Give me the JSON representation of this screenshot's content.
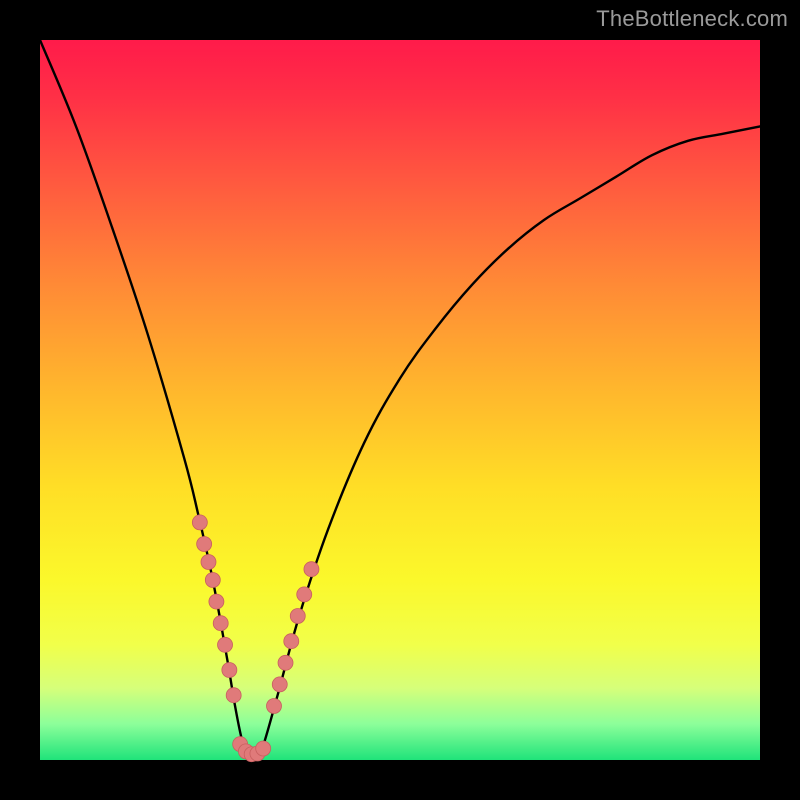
{
  "watermark": "TheBottleneck.com",
  "chart_data": {
    "type": "line",
    "title": "",
    "xlabel": "",
    "ylabel": "",
    "xlim": [
      0,
      100
    ],
    "ylim": [
      0,
      100
    ],
    "grid": false,
    "legend": false,
    "background_gradient": {
      "direction": "vertical",
      "stops": [
        {
          "pos": 0.0,
          "color": "#ff1b4a"
        },
        {
          "pos": 0.5,
          "color": "#ffc228"
        },
        {
          "pos": 0.8,
          "color": "#f8ff3a"
        },
        {
          "pos": 1.0,
          "color": "#1fe37a"
        }
      ]
    },
    "series": [
      {
        "name": "bottleneck-curve",
        "x": [
          0,
          5,
          10,
          15,
          20,
          22,
          24,
          26,
          27,
          28,
          29,
          30,
          31,
          33,
          36,
          40,
          45,
          50,
          55,
          60,
          65,
          70,
          75,
          80,
          85,
          90,
          95,
          100
        ],
        "values": [
          100,
          88,
          74,
          59,
          42,
          34,
          25,
          14,
          8,
          3,
          0,
          0,
          2,
          9,
          20,
          32,
          44,
          53,
          60,
          66,
          71,
          75,
          78,
          81,
          84,
          86,
          87,
          88
        ]
      }
    ],
    "annotations": {
      "dot_clusters": [
        {
          "name": "left-branch-dots",
          "x": [
            22.2,
            22.8,
            23.4,
            24.0,
            24.5,
            25.1,
            25.7,
            26.3,
            26.9
          ],
          "values": [
            33,
            30,
            27.5,
            25,
            22,
            19,
            16,
            12.5,
            9
          ]
        },
        {
          "name": "bottom-dots",
          "x": [
            27.8,
            28.6,
            29.4,
            30.2,
            31.0
          ],
          "values": [
            2.2,
            1.2,
            0.8,
            0.9,
            1.6
          ]
        },
        {
          "name": "right-branch-dots",
          "x": [
            32.5,
            33.3,
            34.1,
            34.9,
            35.8,
            36.7,
            37.7
          ],
          "values": [
            7.5,
            10.5,
            13.5,
            16.5,
            20,
            23,
            26.5
          ]
        }
      ]
    }
  }
}
